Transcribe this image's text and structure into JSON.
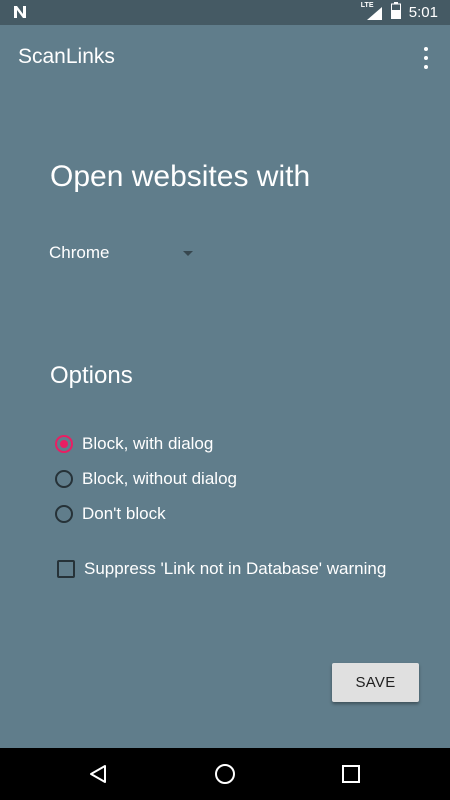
{
  "status_bar": {
    "time": "5:01",
    "network_label": "LTE",
    "icons": [
      "notification-n-icon",
      "lte-signal-icon",
      "battery-icon"
    ]
  },
  "app_bar": {
    "title": "ScanLinks",
    "menu_icon": "overflow-menu-icon"
  },
  "main": {
    "heading": "Open websites with",
    "browser_select": {
      "value": "Chrome"
    },
    "options_heading": "Options",
    "radio_options": [
      {
        "label": "Block, with dialog",
        "checked": true
      },
      {
        "label": "Block, without dialog",
        "checked": false
      },
      {
        "label": "Don't block",
        "checked": false
      }
    ],
    "checkbox": {
      "label": "Suppress 'Link not in Database' warning",
      "checked": false
    },
    "save_label": "SAVE"
  },
  "nav_bar": {
    "icons": [
      "back-icon",
      "home-icon",
      "recents-icon"
    ]
  },
  "colors": {
    "background": "#607D8B",
    "status_bar": "#455A64",
    "accent": "#E91E63",
    "button": "#E0E0E0"
  }
}
